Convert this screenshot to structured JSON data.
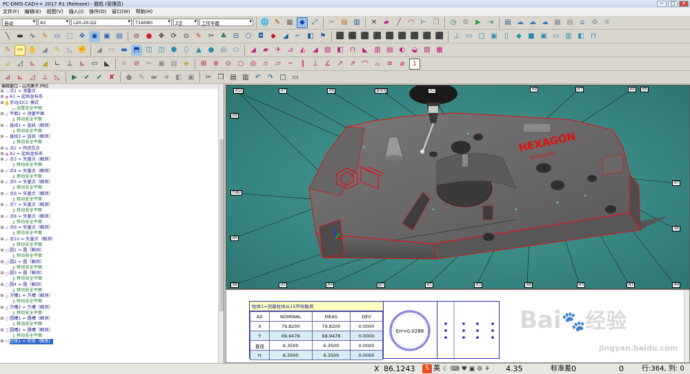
{
  "window": {
    "title": "PC-DMIS CAD++ 2017 R1 (Release) - 脱机 (管理员)"
  },
  "menu": [
    "文件(F)",
    "编辑(E)",
    "视图(V)",
    "插入(I)",
    "操作(O)",
    "窗口(W)",
    "帮助(H)"
  ],
  "combos": {
    "mode": "自动",
    "probe_file": "A2",
    "probe": "L20-20-D2",
    "tip": "T1A0B0",
    "view_set": "Z正",
    "workplane": "工作平面"
  },
  "tree": {
    "header": "编辑窗口 - 山河栗子.PRG",
    "items": [
      {
        "icon": "📄",
        "label": "点1 = 测量点",
        "child": false
      },
      {
        "icon": "⊕",
        "label": "A1 = 起始坐标系",
        "child": false
      },
      {
        "icon": "✋",
        "label": "手动/DCC 模式",
        "child": false
      },
      {
        "icon": "▭",
        "label": "设置安全平面",
        "child": true
      },
      {
        "icon": "◇",
        "label": "平面1 = 测量平面",
        "child": false
      },
      {
        "icon": "↕",
        "label": "移动安全平面",
        "child": true
      },
      {
        "icon": "─",
        "label": "直线1 = 直线（触测）",
        "child": false
      },
      {
        "icon": "↕",
        "label": "移动安全平面",
        "child": true
      },
      {
        "icon": "─",
        "label": "直线3 = 直线（触测）",
        "child": false
      },
      {
        "icon": "↕",
        "label": "移动安全平面",
        "child": true
      },
      {
        "icon": "✕",
        "label": "点2 = 构造交点",
        "child": false
      },
      {
        "icon": "⊕",
        "label": "A2 = 起始坐标系",
        "child": false
      },
      {
        "icon": "✓",
        "label": "点3 = 矢量点（触测）",
        "child": false
      },
      {
        "icon": "↕",
        "label": "移动安全平面",
        "child": true
      },
      {
        "icon": "✓",
        "label": "点4 = 矢量点（触测）",
        "child": false
      },
      {
        "icon": "↕",
        "label": "移动安全平面",
        "child": true
      },
      {
        "icon": "✓",
        "label": "点5 = 矢量点（触测）",
        "child": false
      },
      {
        "icon": "↕",
        "label": "移动安全平面",
        "child": true
      },
      {
        "icon": "✓",
        "label": "点6 = 矢量点（触测）",
        "child": false
      },
      {
        "icon": "↕",
        "label": "移动安全平面",
        "child": true
      },
      {
        "icon": "✓",
        "label": "点7 = 矢量点（触测）",
        "child": false
      },
      {
        "icon": "↕",
        "label": "移动安全平面",
        "child": true
      },
      {
        "icon": "✓",
        "label": "点8 = 矢量点（触测）",
        "child": false
      },
      {
        "icon": "↕",
        "label": "移动安全平面",
        "child": true
      },
      {
        "icon": "✓",
        "label": "点9 = 矢量点（触测）",
        "child": false
      },
      {
        "icon": "↕",
        "label": "移动安全平面",
        "child": true
      },
      {
        "icon": "✓",
        "label": "点10 = 矢量点（触测）",
        "child": false
      },
      {
        "icon": "↕",
        "label": "移动安全平面",
        "child": true
      },
      {
        "icon": "○",
        "label": "圆1 = 圆（触测）",
        "child": false
      },
      {
        "icon": "↕",
        "label": "移动安全平面",
        "child": true
      },
      {
        "icon": "○",
        "label": "圆2 = 圆（触测）",
        "child": false
      },
      {
        "icon": "↕",
        "label": "移动安全平面",
        "child": true
      },
      {
        "icon": "○",
        "label": "圆3 = 圆（触测）",
        "child": false
      },
      {
        "icon": "↕",
        "label": "移动安全平面",
        "child": true
      },
      {
        "icon": "○",
        "label": "圆4 = 圆（触测）",
        "child": false
      },
      {
        "icon": "↕",
        "label": "移动安全平面",
        "child": true
      },
      {
        "icon": "▯",
        "label": "方槽1 = 方槽（触测）",
        "child": false
      },
      {
        "icon": "↕",
        "label": "移动安全平面",
        "child": true
      },
      {
        "icon": "▯",
        "label": "方槽2 = 方槽（触测）",
        "child": false
      },
      {
        "icon": "↕",
        "label": "移动安全平面",
        "child": true
      },
      {
        "icon": "⬯",
        "label": "圆槽1 = 圆槽（触测）",
        "child": false
      },
      {
        "icon": "↕",
        "label": "移动安全平面",
        "child": true
      },
      {
        "icon": "⬯",
        "label": "圆槽2 = 圆槽（触测）",
        "child": false
      },
      {
        "icon": "↕",
        "label": "移动安全平面",
        "child": true
      },
      {
        "icon": "⬭",
        "label": "柱体1 = 柱体（触测）",
        "child": false,
        "selected": true
      }
    ]
  },
  "viewport": {
    "labels": [
      "点10",
      "点7",
      "点6",
      "点3",
      "直线3",
      "点2",
      "点7",
      "点5",
      "方槽2",
      "点6",
      "点6",
      "点5",
      "点4",
      "圆3",
      "点1",
      "点2",
      "点8",
      "点3",
      "点2",
      "点7",
      "点6",
      "点4",
      "点9",
      "点8",
      "点5"
    ],
    "logo": "HEXAGON",
    "logo_sub": "METROLOGY"
  },
  "report": {
    "title": "柱体1=测量柱体从15开始触测",
    "headers": [
      "AX",
      "NOMINAL",
      "MEAS",
      "DEV"
    ],
    "rows": [
      [
        "X",
        "79.8200",
        "79.8200",
        "0.0000"
      ],
      [
        "Y",
        "69.9478",
        "69.9478",
        "0.0000"
      ],
      [
        "直径",
        "6.3500",
        "6.3500",
        "0.0000"
      ],
      [
        "H",
        "6.3500",
        "6.3500",
        "0.0000"
      ]
    ],
    "err_label": "Err=0.0288"
  },
  "status": {
    "x_label": "X",
    "x_value": "86.1243",
    "ime": "英",
    "z_value": "4.35",
    "std_label": "标准差",
    "std_value": "0",
    "zero": "0",
    "rowcol": "行:364, 列: 0"
  },
  "watermark": {
    "brand": "Bai",
    "brand2": "经验",
    "url": "jingyan.baidu.com"
  },
  "colors": {
    "viewport": "#3a8a86",
    "part": "#6f6e6e",
    "edge": "#e01010",
    "selection": "#316ac5"
  }
}
